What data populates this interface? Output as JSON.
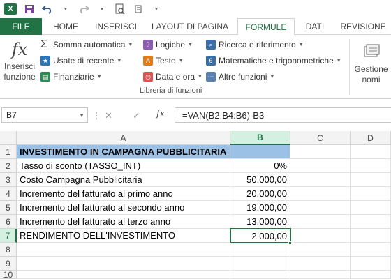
{
  "qat": {
    "app_icon": "X",
    "icons": [
      "excel-icon",
      "save-icon",
      "undo-icon",
      "redo-icon",
      "print-preview-icon",
      "customize-icon"
    ]
  },
  "tabs": [
    {
      "label": "FILE"
    },
    {
      "label": "HOME"
    },
    {
      "label": "INSERISCI"
    },
    {
      "label": "LAYOUT DI PAGINA"
    },
    {
      "label": "FORMULE"
    },
    {
      "label": "DATI"
    },
    {
      "label": "REVISIONE"
    }
  ],
  "ribbon": {
    "insert_function": {
      "line1": "Inserisci",
      "line2": "funzione"
    },
    "col1": [
      {
        "label": "Somma automatica"
      },
      {
        "label": "Usate di recente"
      },
      {
        "label": "Finanziarie"
      }
    ],
    "col2": [
      {
        "label": "Logiche"
      },
      {
        "label": "Testo"
      },
      {
        "label": "Data e ora"
      }
    ],
    "col3": [
      {
        "label": "Ricerca e riferimento"
      },
      {
        "label": "Matematiche e trigonometriche"
      },
      {
        "label": "Altre funzioni"
      }
    ],
    "group_label": "Libreria di funzioni",
    "name_manager": {
      "line1": "Gestione",
      "line2": "nomi"
    }
  },
  "formula_bar": {
    "name_box": "B7",
    "fx": "fx",
    "formula": "=VAN(B2;B4:B6)-B3"
  },
  "grid": {
    "columns": [
      "A",
      "B",
      "C",
      "D"
    ],
    "rows": [
      "1",
      "2",
      "3",
      "4",
      "5",
      "6",
      "7",
      "8",
      "9",
      "10"
    ],
    "cells": [
      {
        "a": "INVESTIMENTO IN CAMPAGNA PUBBLICITARIA",
        "b": ""
      },
      {
        "a": "Tasso di sconto (TASSO_INT)",
        "b": "0%"
      },
      {
        "a": "Costo Campagna Pubblicitaria",
        "b": "50.000,00"
      },
      {
        "a": "Incremento del fatturato al primo anno",
        "b": "20.000,00"
      },
      {
        "a": "Incremento del fatturato al secondo anno",
        "b": "19.000,00"
      },
      {
        "a": "Incremento del fatturato al terzo anno",
        "b": "13.000,00"
      },
      {
        "a": "RENDIMENTO DELL'INVESTIMENTO",
        "b": "2.000,00"
      }
    ],
    "header_fill": "#9bc2e6",
    "accent": "#217346"
  }
}
